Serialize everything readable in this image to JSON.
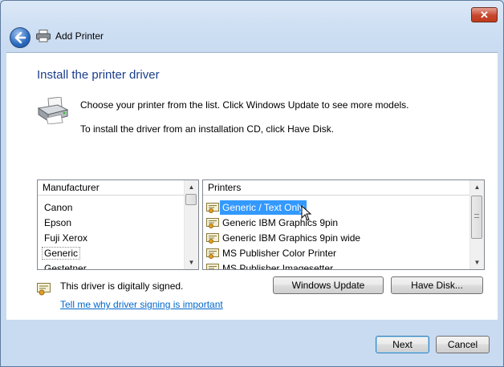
{
  "window": {
    "title": "Add Printer",
    "close_glyph": "✕"
  },
  "page": {
    "heading": "Install the printer driver",
    "description_line1": "Choose your printer from the list. Click Windows Update to see more models.",
    "description_line2": "To install the driver from an installation CD, click Have Disk."
  },
  "manufacturer_list": {
    "header": "Manufacturer",
    "items": [
      "Canon",
      "Epson",
      "Fuji Xerox",
      "Generic",
      "Gestetner"
    ],
    "selected": "Generic"
  },
  "printer_list": {
    "header": "Printers",
    "items": [
      "Generic / Text Only",
      "Generic IBM Graphics 9pin",
      "Generic IBM Graphics 9pin wide",
      "MS Publisher Color Printer",
      "MS Publisher Imagesetter"
    ],
    "selected": "Generic / Text Only"
  },
  "signing": {
    "status": "This driver is digitally signed.",
    "link": "Tell me why driver signing is important"
  },
  "buttons": {
    "windows_update": "Windows Update",
    "have_disk": "Have Disk...",
    "next": "Next",
    "cancel": "Cancel"
  },
  "icons": {
    "back": "back-arrow-icon",
    "printer": "printer-icon",
    "driver": "driver-certificate-icon",
    "cursor": "mouse-cursor-icon"
  },
  "colors": {
    "accent_heading": "#1a3e8c",
    "selection": "#3399ff",
    "link": "#0066cc"
  }
}
